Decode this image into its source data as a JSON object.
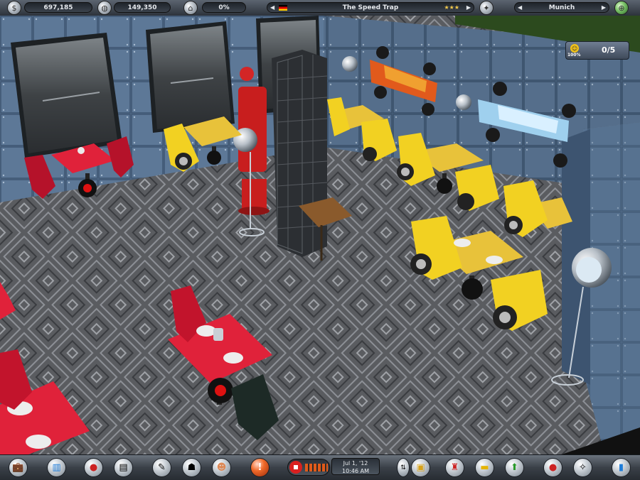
{
  "topbar": {
    "money": "697,185",
    "guests": "149,350",
    "percent": "0%",
    "restaurant_name": "The Speed Trap",
    "stars": "★★★",
    "city": "Munich"
  },
  "satisfaction_counter": {
    "rating": "100%",
    "value": "0/5"
  },
  "clock": {
    "date": "Jul 1, '12",
    "time": "10:46 AM"
  },
  "colors": {
    "floor": "#5a5c60",
    "wall": "#566f8c",
    "red_table": "#e0223a",
    "yellow_table": "#e8c23a"
  },
  "bottombar": {
    "buttons": [
      {
        "icon": "briefcase-icon"
      },
      {
        "icon": "statistics-icon"
      },
      {
        "icon": "food-icon"
      },
      {
        "icon": "recipe-book-icon"
      },
      {
        "icon": "notepad-icon"
      },
      {
        "icon": "staff-icon"
      },
      {
        "icon": "guests-icon"
      },
      {
        "icon": "alert-icon"
      },
      {
        "icon": "rotate-camera-icon"
      },
      {
        "icon": "build-box-icon"
      },
      {
        "icon": "furniture-icon"
      },
      {
        "icon": "construction-icon"
      },
      {
        "icon": "move-object-icon"
      },
      {
        "icon": "sell-icon"
      },
      {
        "icon": "cleaning-icon"
      },
      {
        "icon": "options-icon"
      }
    ]
  }
}
